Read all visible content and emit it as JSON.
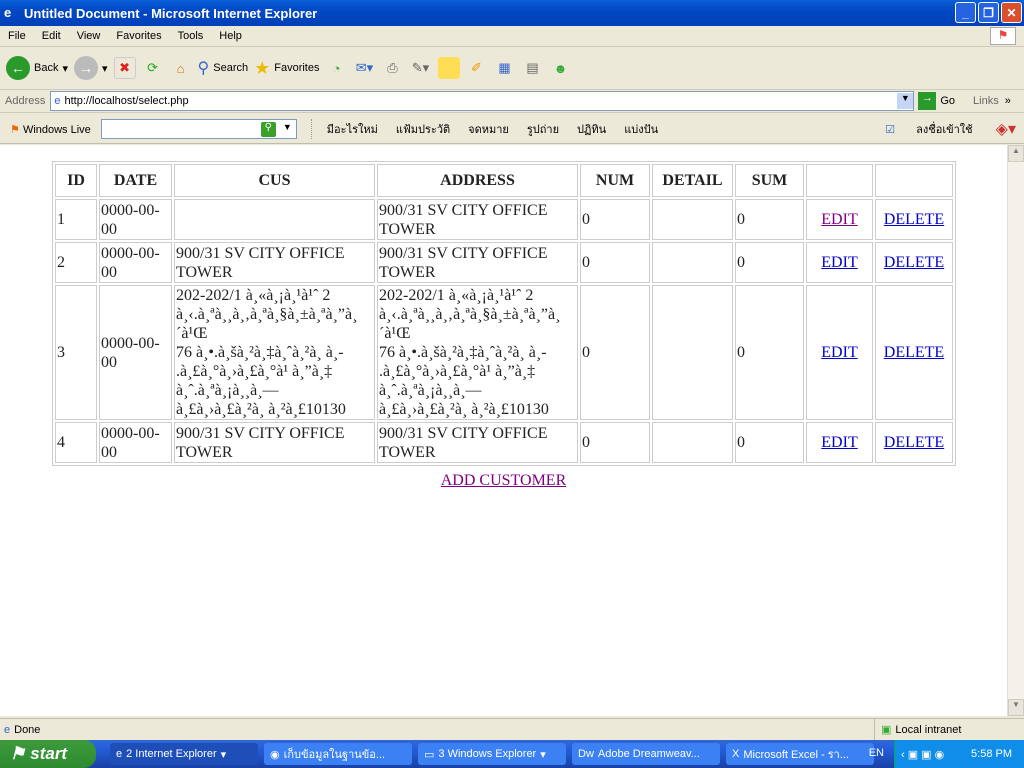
{
  "window": {
    "title": "Untitled Document - Microsoft Internet Explorer"
  },
  "menu": [
    "File",
    "Edit",
    "View",
    "Favorites",
    "Tools",
    "Help"
  ],
  "toolbar": {
    "back": "Back",
    "search": "Search",
    "favorites": "Favorites"
  },
  "address": {
    "label": "Address",
    "url": "http://localhost/select.php",
    "go": "Go",
    "links": "Links"
  },
  "live": {
    "brand": "Windows Live",
    "search_value": "",
    "items": [
      "มีอะไรใหม่",
      "แฟ้มประวัติ",
      "จดหมาย",
      "รูปถ่าย",
      "ปฏิทิน",
      "แบ่งปัน"
    ],
    "signin": "ลงชื่อเข้าใช้"
  },
  "table": {
    "headers": [
      "ID",
      "DATE",
      "CUS",
      "ADDRESS",
      "NUM",
      "DETAIL",
      "SUM",
      "",
      ""
    ],
    "rows": [
      {
        "id": "1",
        "date": "0000-00-\n00",
        "cus": "",
        "address": "900/31 SV CITY OFFICE\nTOWER",
        "num": "0",
        "detail": "",
        "sum": "0",
        "edit": "EDIT",
        "delete": "DELETE"
      },
      {
        "id": "2",
        "date": "0000-00-\n00",
        "cus": "900/31 SV CITY OFFICE\nTOWER",
        "address": "900/31 SV CITY OFFICE\nTOWER",
        "num": "0",
        "detail": "",
        "sum": "0",
        "edit": "EDIT",
        "delete": "DELETE"
      },
      {
        "id": "3",
        "date": "0000-00-\n00",
        "cus": "202-202/1 à¸«à¸¡à¸¹à¹ˆ 2\nà¸‹.à¸ªà¸¸à¸‚à¸ªà¸§à¸±à¸ªà¸”à¸´à¹Œ\n76 à¸•.à¸šà¸²à¸‡à¸ˆà¸²à¸  à¸-\n.à¸£à¸°à¸›à¸£à¸°à¹  à¸”à¸‡\nà¸ˆ.à¸ªà¸¡à¸¸à¸—\nà¸£à¸›à¸£à¸²à¸  à¸²à¸£10130",
        "address": "202-202/1 à¸«à¸¡à¸¹à¹ˆ 2\nà¸‹.à¸ªà¸¸à¸‚à¸ªà¸§à¸±à¸ªà¸”à¸´à¹Œ\n76 à¸•.à¸šà¸²à¸‡à¸ˆà¸²à¸  à¸-\n.à¸£à¸°à¸›à¸£à¸°à¹  à¸”à¸‡\nà¸ˆ.à¸ªà¸¡à¸¸à¸—\nà¸£à¸›à¸£à¸²à¸  à¸²à¸£10130",
        "num": "0",
        "detail": "",
        "sum": "0",
        "edit": "EDIT",
        "delete": "DELETE"
      },
      {
        "id": "4",
        "date": "0000-00-\n00",
        "cus": "900/31 SV CITY OFFICE\nTOWER",
        "address": "900/31 SV CITY OFFICE\nTOWER",
        "num": "0",
        "detail": "",
        "sum": "0",
        "edit": "EDIT",
        "delete": "DELETE"
      }
    ]
  },
  "add_customer": "ADD CUSTOMER",
  "status": {
    "text": "Done",
    "zone": "Local intranet"
  },
  "taskbar": {
    "start": "start",
    "tasks": [
      "2 Internet Explorer",
      "เก็บข้อมูลในฐานข้อ...",
      "3 Windows Explorer",
      "Adobe Dreamweav...",
      "Microsoft Excel - รา..."
    ],
    "lang": "EN",
    "time": "5:58 PM"
  }
}
